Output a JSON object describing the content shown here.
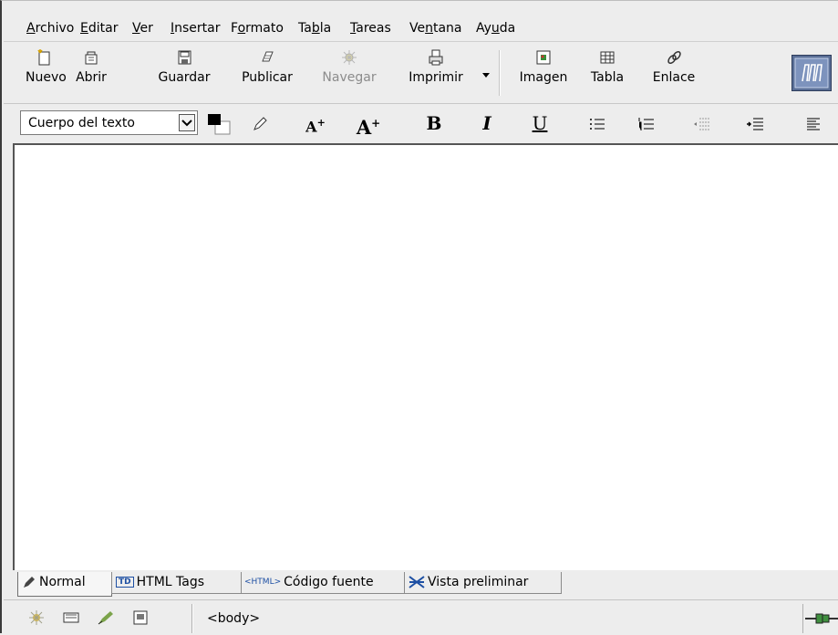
{
  "menu": {
    "items": [
      {
        "label": "Archivo",
        "mnemonic": "A"
      },
      {
        "label": "Editar",
        "mnemonic": "E"
      },
      {
        "label": "Ver",
        "mnemonic": "V"
      },
      {
        "label": "Insertar",
        "mnemonic": "I"
      },
      {
        "label": "Formato",
        "mnemonic": "o"
      },
      {
        "label": "Tabla",
        "mnemonic": "b"
      },
      {
        "label": "Tareas",
        "mnemonic": "T"
      },
      {
        "label": "Ventana",
        "mnemonic": "n"
      },
      {
        "label": "Ayuda",
        "mnemonic": "u"
      }
    ]
  },
  "toolbar": {
    "new_label": "Nuevo",
    "open_label": "Abrir",
    "save_label": "Guardar",
    "publish_label": "Publicar",
    "browse_label": "Navegar",
    "print_label": "Imprimir",
    "image_label": "Imagen",
    "table_label": "Tabla",
    "link_label": "Enlace"
  },
  "format": {
    "paragraph_style": "Cuerpo del texto",
    "text_color": "#000000",
    "background_color": "#ffffff",
    "bold_label": "B",
    "italic_label": "I",
    "underline_label": "U"
  },
  "tabs": [
    {
      "label": "Normal",
      "active": true
    },
    {
      "label": "HTML Tags",
      "icon_text": "TD"
    },
    {
      "label": "Código fuente",
      "icon_text": "<HTML>"
    },
    {
      "label": "Vista preliminar"
    }
  ],
  "status": {
    "element_path": "<body>"
  }
}
